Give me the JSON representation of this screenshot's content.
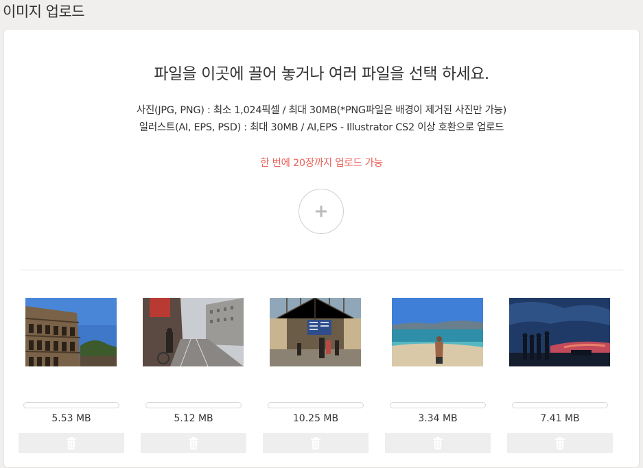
{
  "page": {
    "title": "이미지 업로드"
  },
  "dropzone": {
    "headline": "파일을 이곳에 끌어 놓거나 여러 파일을 선택 하세요.",
    "rule_photo": "사진(JPG, PNG) : 최소 1,024픽셀 / 최대 30MB(*PNG파일은 배경이 제거된 사진만 가능)",
    "rule_illust": "일러스트(AI, EPS, PSD) : 최대 30MB / AI,EPS - Illustrator CS2 이상 호환으로 업로드",
    "limit_notice": "한 번에 20장까지 업로드 가능",
    "add_icon": "plus-icon",
    "limit_color": "#e8625b"
  },
  "uploads": [
    {
      "size": "5.53 MB",
      "progress": 0,
      "subject": "colosseum",
      "delete_icon": "trash-icon"
    },
    {
      "size": "5.12 MB",
      "progress": 0,
      "subject": "city-street",
      "delete_icon": "trash-icon"
    },
    {
      "size": "10.25 MB",
      "progress": 0,
      "subject": "train-station",
      "delete_icon": "trash-icon"
    },
    {
      "size": "3.34 MB",
      "progress": 0,
      "subject": "beach",
      "delete_icon": "trash-icon"
    },
    {
      "size": "7.41 MB",
      "progress": 0,
      "subject": "sunset-silhouettes",
      "delete_icon": "trash-icon"
    }
  ]
}
